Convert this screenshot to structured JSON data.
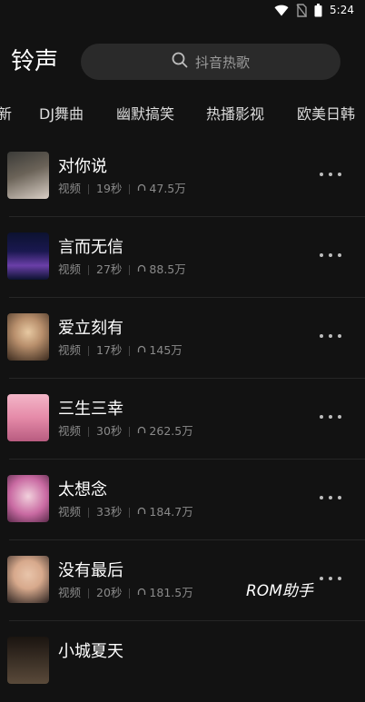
{
  "status_bar": {
    "time": "5:24",
    "icons": [
      "wifi-icon",
      "no-sim-icon",
      "battery-icon"
    ]
  },
  "header": {
    "title": "铃声",
    "search": {
      "placeholder": "抖音热歌",
      "icon": "search-icon"
    }
  },
  "tabs": [
    {
      "label": "新"
    },
    {
      "label": "DJ舞曲"
    },
    {
      "label": "幽默搞笑"
    },
    {
      "label": "热播影视"
    },
    {
      "label": "欧美日韩"
    }
  ],
  "list": [
    {
      "title": "对你说",
      "type": "视频",
      "duration": "19秒",
      "plays": "47.5万",
      "thumb_colors": [
        "#3b3b38",
        "#d9cfc6"
      ]
    },
    {
      "title": "言而无信",
      "type": "视频",
      "duration": "27秒",
      "plays": "88.5万",
      "thumb_colors": [
        "#0c1230",
        "#6a3fa8"
      ]
    },
    {
      "title": "爱立刻有",
      "type": "视频",
      "duration": "17秒",
      "plays": "145万",
      "thumb_colors": [
        "#e7c9a2",
        "#3a2a1e"
      ]
    },
    {
      "title": "三生三幸",
      "type": "视频",
      "duration": "30秒",
      "plays": "262.5万",
      "thumb_colors": [
        "#e58aa8",
        "#f3b6c8"
      ]
    },
    {
      "title": "太想念",
      "type": "视频",
      "duration": "33秒",
      "plays": "184.7万",
      "thumb_colors": [
        "#c96aa2",
        "#f1d0dc"
      ]
    },
    {
      "title": "没有最后",
      "type": "视频",
      "duration": "20秒",
      "plays": "181.5万",
      "thumb_colors": [
        "#d7a98c",
        "#2b2220"
      ]
    },
    {
      "title": "小城夏天",
      "type": "",
      "duration": "",
      "plays": "",
      "thumb_colors": [
        "#1a1410",
        "#5a4a3a"
      ]
    }
  ],
  "watermark": "ROM助手",
  "colors": {
    "background": "#121212",
    "search_bg": "#2a2a2a",
    "secondary_text": "#8a8a8a"
  }
}
